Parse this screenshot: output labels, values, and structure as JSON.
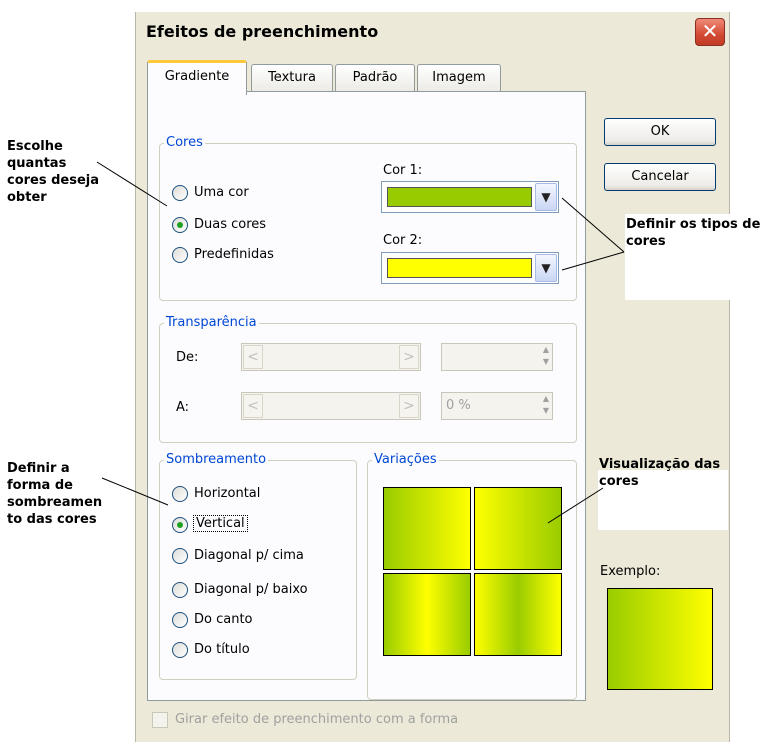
{
  "dialog": {
    "title": "Efeitos de preenchimento",
    "close_glyph": "✕"
  },
  "tabs": [
    {
      "label": "Gradiente",
      "active": true
    },
    {
      "label": "Textura",
      "active": false
    },
    {
      "label": "Padrão",
      "active": false
    },
    {
      "label": "Imagem",
      "active": false
    }
  ],
  "cores": {
    "legend": "Cores",
    "options": [
      {
        "label": "Uma cor",
        "selected": false
      },
      {
        "label": "Duas cores",
        "selected": true
      },
      {
        "label": "Predefinidas",
        "selected": false
      }
    ],
    "cor1": {
      "label": "Cor 1:",
      "color": "#99cc00"
    },
    "cor2": {
      "label": "Cor 2:",
      "color": "#ffff00"
    },
    "dropdown_glyph": "▼"
  },
  "transparencia": {
    "legend": "Transparência",
    "de": {
      "label": "De:",
      "value": ""
    },
    "a": {
      "label": "A:",
      "value": "0 %"
    },
    "left_arrow": "<",
    "right_arrow": ">",
    "spin_up": "▲",
    "spin_down": "▼"
  },
  "sombreamento": {
    "legend": "Sombreamento",
    "options": [
      {
        "label": "Horizontal",
        "selected": false
      },
      {
        "label": "Vertical",
        "selected": true
      },
      {
        "label": "Diagonal p/ cima",
        "selected": false
      },
      {
        "label": "Diagonal p/ baixo",
        "selected": false
      },
      {
        "label": "Do canto",
        "selected": false
      },
      {
        "label": "Do título",
        "selected": false
      }
    ]
  },
  "variacoes": {
    "legend": "Variações"
  },
  "buttons": {
    "ok": "OK",
    "cancel": "Cancelar"
  },
  "exemplo": {
    "label": "Exemplo:"
  },
  "rotate_checkbox": {
    "label": "Girar efeito de preenchimento com a forma",
    "checked": false,
    "enabled": false
  },
  "annotations": {
    "escolhe": [
      "Escolhe",
      "quantas",
      "cores deseja",
      "obter"
    ],
    "definir_tipos": [
      "Definir os tipos de",
      "cores"
    ],
    "definir_forma": [
      "Definir a",
      "forma de",
      "sombreamen",
      "to das cores"
    ],
    "visualizacao": [
      "Visualização das",
      "cores"
    ]
  },
  "colors": {
    "gradient_start": "#99cc00",
    "gradient_end": "#ffff00",
    "accent": "#0046d5"
  }
}
